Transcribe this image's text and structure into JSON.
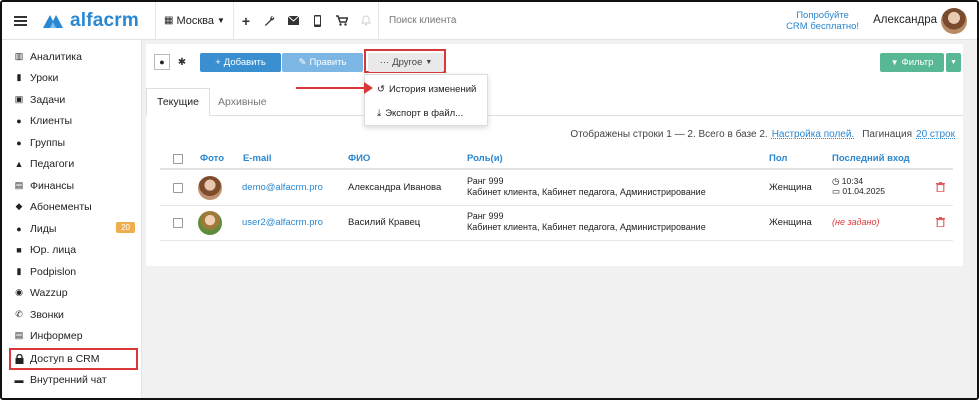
{
  "topbar": {
    "logo": "alfacrm",
    "branch": "Москва",
    "tools": [
      "plus-icon",
      "wrench-icon",
      "mail-icon",
      "phone-icon",
      "cart-icon",
      "bell-icon"
    ],
    "search_placeholder": "Поиск клиента",
    "promo_line1": "Попробуйте",
    "promo_line2": "CRM бесплатно!",
    "user_name": "Александра"
  },
  "sidebar": {
    "items": [
      {
        "label": "Аналитика",
        "icon": "map-icon"
      },
      {
        "label": "Уроки",
        "icon": "book-icon"
      },
      {
        "label": "Задачи",
        "icon": "calendar-check-icon"
      },
      {
        "label": "Клиенты",
        "icon": "user-icon"
      },
      {
        "label": "Группы",
        "icon": "users-icon"
      },
      {
        "label": "Педагоги",
        "icon": "graduation-cap-icon"
      },
      {
        "label": "Финансы",
        "icon": "money-icon"
      },
      {
        "label": "Абонементы",
        "icon": "tag-icon"
      },
      {
        "label": "Лиды",
        "icon": "user-plus-icon",
        "badge": "20"
      },
      {
        "label": "Юр. лица",
        "icon": "briefcase-icon"
      },
      {
        "label": "Podpislon",
        "icon": "mobile-icon"
      },
      {
        "label": "Wazzup",
        "icon": "whatsapp-icon"
      },
      {
        "label": "Звонки",
        "icon": "phone-icon"
      },
      {
        "label": "Информер",
        "icon": "list-icon"
      },
      {
        "label": "Доступ в CRM",
        "icon": "lock-icon"
      },
      {
        "label": "Внутренний чат",
        "icon": "chat-icon"
      }
    ]
  },
  "toolbar": {
    "add_label": "Добавить",
    "edit_label": "Править",
    "other_label": "Другое",
    "filter_label": "Фильтр"
  },
  "dropdown": {
    "history_label": "История изменений",
    "export_label": "Экспорт в файл..."
  },
  "tabs": {
    "current": "Текущие",
    "archive": "Архивные"
  },
  "info": {
    "shown": "Отображены строки 1 — 2. Всего в базе 2.",
    "settings_link": "Настройка полей.",
    "pagination_label": "Пагинация",
    "pagination_value": "20 строк"
  },
  "table": {
    "headers": {
      "photo": "Фото",
      "email": "E-mail",
      "fio": "ФИО",
      "roles": "Роль(и)",
      "gender": "Пол",
      "last_login": "Последний вход"
    },
    "rows": [
      {
        "email": "demo@alfacrm.pro",
        "fio": "Александра Иванова",
        "rank": "Ранг 999",
        "roles": "Кабинет клиента, Кабинет педагога, Администрирование",
        "gender": "Женщина",
        "time": "10:34",
        "date": "01.04.2025"
      },
      {
        "email": "user2@alfacrm.pro",
        "fio": "Василий Кравец",
        "rank": "Ранг 999",
        "roles": "Кабинет клиента, Кабинет педагога, Администрирование",
        "gender": "Женщина",
        "not_set": "(не задано)"
      }
    ]
  }
}
